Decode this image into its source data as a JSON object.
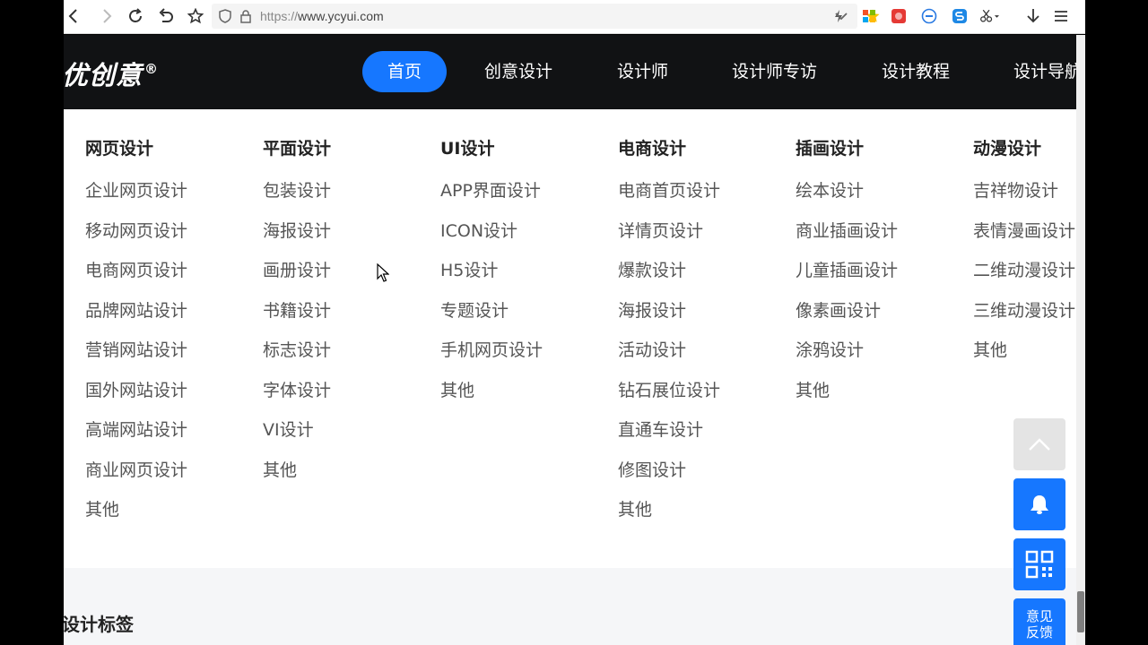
{
  "browser": {
    "url_protocol": "https://",
    "url_host": "www.ycyui.com"
  },
  "header": {
    "logo": "优创意",
    "logo_mark": "®",
    "nav": [
      {
        "label": "首页",
        "active": true
      },
      {
        "label": "创意设计"
      },
      {
        "label": "设计师"
      },
      {
        "label": "设计师专访"
      },
      {
        "label": "设计教程"
      },
      {
        "label": "设计导航"
      }
    ]
  },
  "menu": {
    "columns": [
      {
        "title": "网页设计",
        "items": [
          "企业网页设计",
          "移动网页设计",
          "电商网页设计",
          "品牌网站设计",
          "营销网站设计",
          "国外网站设计",
          "高端网站设计",
          "商业网页设计",
          "其他"
        ]
      },
      {
        "title": "平面设计",
        "items": [
          "包装设计",
          "海报设计",
          "画册设计",
          "书籍设计",
          "标志设计",
          "字体设计",
          "VI设计",
          "其他"
        ]
      },
      {
        "title": "UI设计",
        "items": [
          "APP界面设计",
          "ICON设计",
          "H5设计",
          "专题设计",
          "手机网页设计",
          "其他"
        ]
      },
      {
        "title": "电商设计",
        "items": [
          "电商首页设计",
          "详情页设计",
          "爆款设计",
          "海报设计",
          "活动设计",
          "钻石展位设计",
          "直通车设计",
          "修图设计",
          "其他"
        ]
      },
      {
        "title": "插画设计",
        "items": [
          "绘本设计",
          "商业插画设计",
          "儿童插画设计",
          "像素画设计",
          "涂鸦设计",
          "其他"
        ]
      },
      {
        "title": "动漫设计",
        "items": [
          "吉祥物设计",
          "表情漫画设计",
          "二维动漫设计",
          "三维动漫设计",
          "其他"
        ]
      }
    ]
  },
  "section": {
    "title": "设计标签"
  },
  "float": {
    "feedback_line1": "意见",
    "feedback_line2": "反馈"
  },
  "colors": {
    "accent": "#1677ff",
    "header_bg": "#111214"
  }
}
